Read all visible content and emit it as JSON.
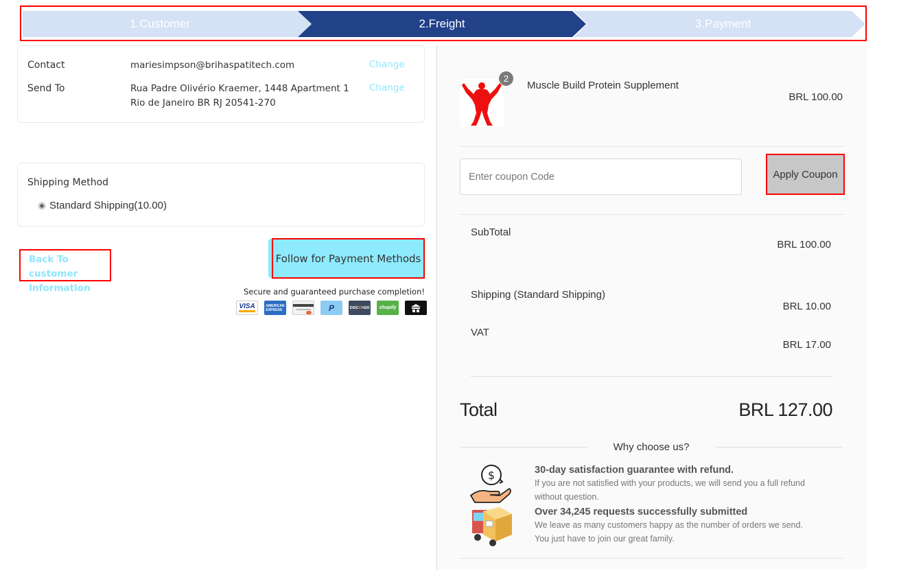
{
  "steps": [
    {
      "label": "1.Customer"
    },
    {
      "label": "2.Freight"
    },
    {
      "label": "3.Payment"
    }
  ],
  "contact": {
    "contact_label": "Contact",
    "email": "mariesimpson@brihaspatitech.com",
    "send_to_label": "Send To",
    "address_line1": "Rua Padre Olivério Kraemer, 1448 Apartment 1",
    "address_line2": "Rio de Janeiro BR RJ 20541-270",
    "change_label": "Change"
  },
  "shipping": {
    "title": "Shipping Method",
    "option": "Standard Shipping(10.00)"
  },
  "actions": {
    "back_line1": "Back To customer",
    "back_line2": "Information",
    "follow": "Follow for Payment Methods"
  },
  "secure_text": "Secure and guaranteed purchase completion!",
  "payment_icons": [
    "VISA",
    "AMEX",
    "Card",
    "PayPal",
    "DISCOVER",
    "shopify",
    "store"
  ],
  "product": {
    "quantity": "2",
    "name": "Muscle Build Protein Supplement",
    "price": "BRL 100.00"
  },
  "coupon": {
    "placeholder": "Enter coupon Code",
    "apply": "Apply Coupon"
  },
  "summary": {
    "subtotal_label": "SubTotal",
    "subtotal": "BRL 100.00",
    "shipping_label": "Shipping (Standard Shipping)",
    "shipping": "BRL 10.00",
    "vat_label": "VAT",
    "vat": "BRL 17.00",
    "total_label": "Total",
    "total": "BRL 127.00"
  },
  "why": {
    "title": "Why choose us?",
    "f1_title": "30-day satisfaction guarantee with refund.",
    "f1_line1": "If you are not satisfied with your products, we will send you a full refund",
    "f1_line2": "without question.",
    "f2_title": "Over 34,245 requests successfully submitted",
    "f2_line1": "We leave as many customers happy as the number of orders we send.",
    "f2_line2": "You just have to join our great family."
  },
  "colors": {
    "step_active": "#214189",
    "step_inactive": "#d5e1f5",
    "link": "#8ee6fb",
    "follow_bg": "#8eeafd",
    "highlight_border": "#ff0000"
  }
}
